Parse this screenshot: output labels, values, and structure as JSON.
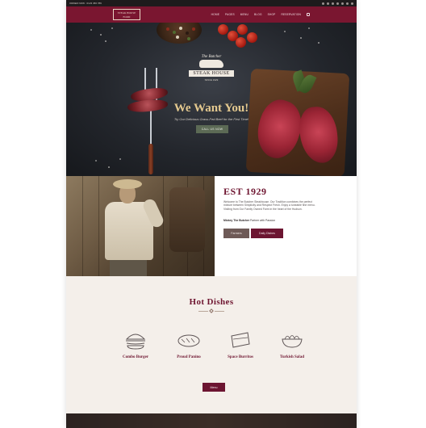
{
  "topbar": {
    "contact": "ORDER NOW : 0123 456 789",
    "icons": [
      "facebook-icon",
      "twitter-icon",
      "instagram-icon",
      "google-icon",
      "pinterest-icon",
      "search-icon",
      "cart-icon"
    ]
  },
  "nav": {
    "logo_line1": "STEAK HOUSE",
    "logo_line2": "FOOD",
    "items": [
      "HOME",
      "PAGES",
      "MENU",
      "BLOG",
      "SHOP",
      "RESERVATION"
    ]
  },
  "hero": {
    "brand_top": "The Butcher",
    "brand_banner": "STEAK HOUSE",
    "brand_bottom": "SINCE 1929",
    "title": "We Want You!",
    "subtitle": "Try Our Delicious Grass-Fed Beef for the First Time!",
    "button": "CALL US NOW"
  },
  "about": {
    "title": "EST 1929",
    "text": "Welcome to The Butcher Steakhouse. Our Tradition combines the perfect mixture between Simplicity and Respect Fresh. Enjoy a tuneable fine menu. Visiting from Our Family Owned Farm in the heart of the Hudson.",
    "signature_name": "Mickey The Butcher",
    "signature_role": "Partner with Passion",
    "button_farmers": "Farmers",
    "button_dishes": "Daily Dishes"
  },
  "dishes": {
    "title": "Hot Dishes",
    "items": [
      {
        "label": "Combo Burger",
        "icon": "burger-icon"
      },
      {
        "label": "Proud Panino",
        "icon": "panino-icon"
      },
      {
        "label": "Space Burritos",
        "icon": "burrito-icon"
      },
      {
        "label": "Turkish Salad",
        "icon": "salad-icon"
      }
    ],
    "menu_button": "Menu"
  },
  "colors": {
    "brand": "#7a1630",
    "accent_gold": "#e4c98f",
    "button_green": "#5c6a55",
    "section_bg": "#f4efea"
  }
}
